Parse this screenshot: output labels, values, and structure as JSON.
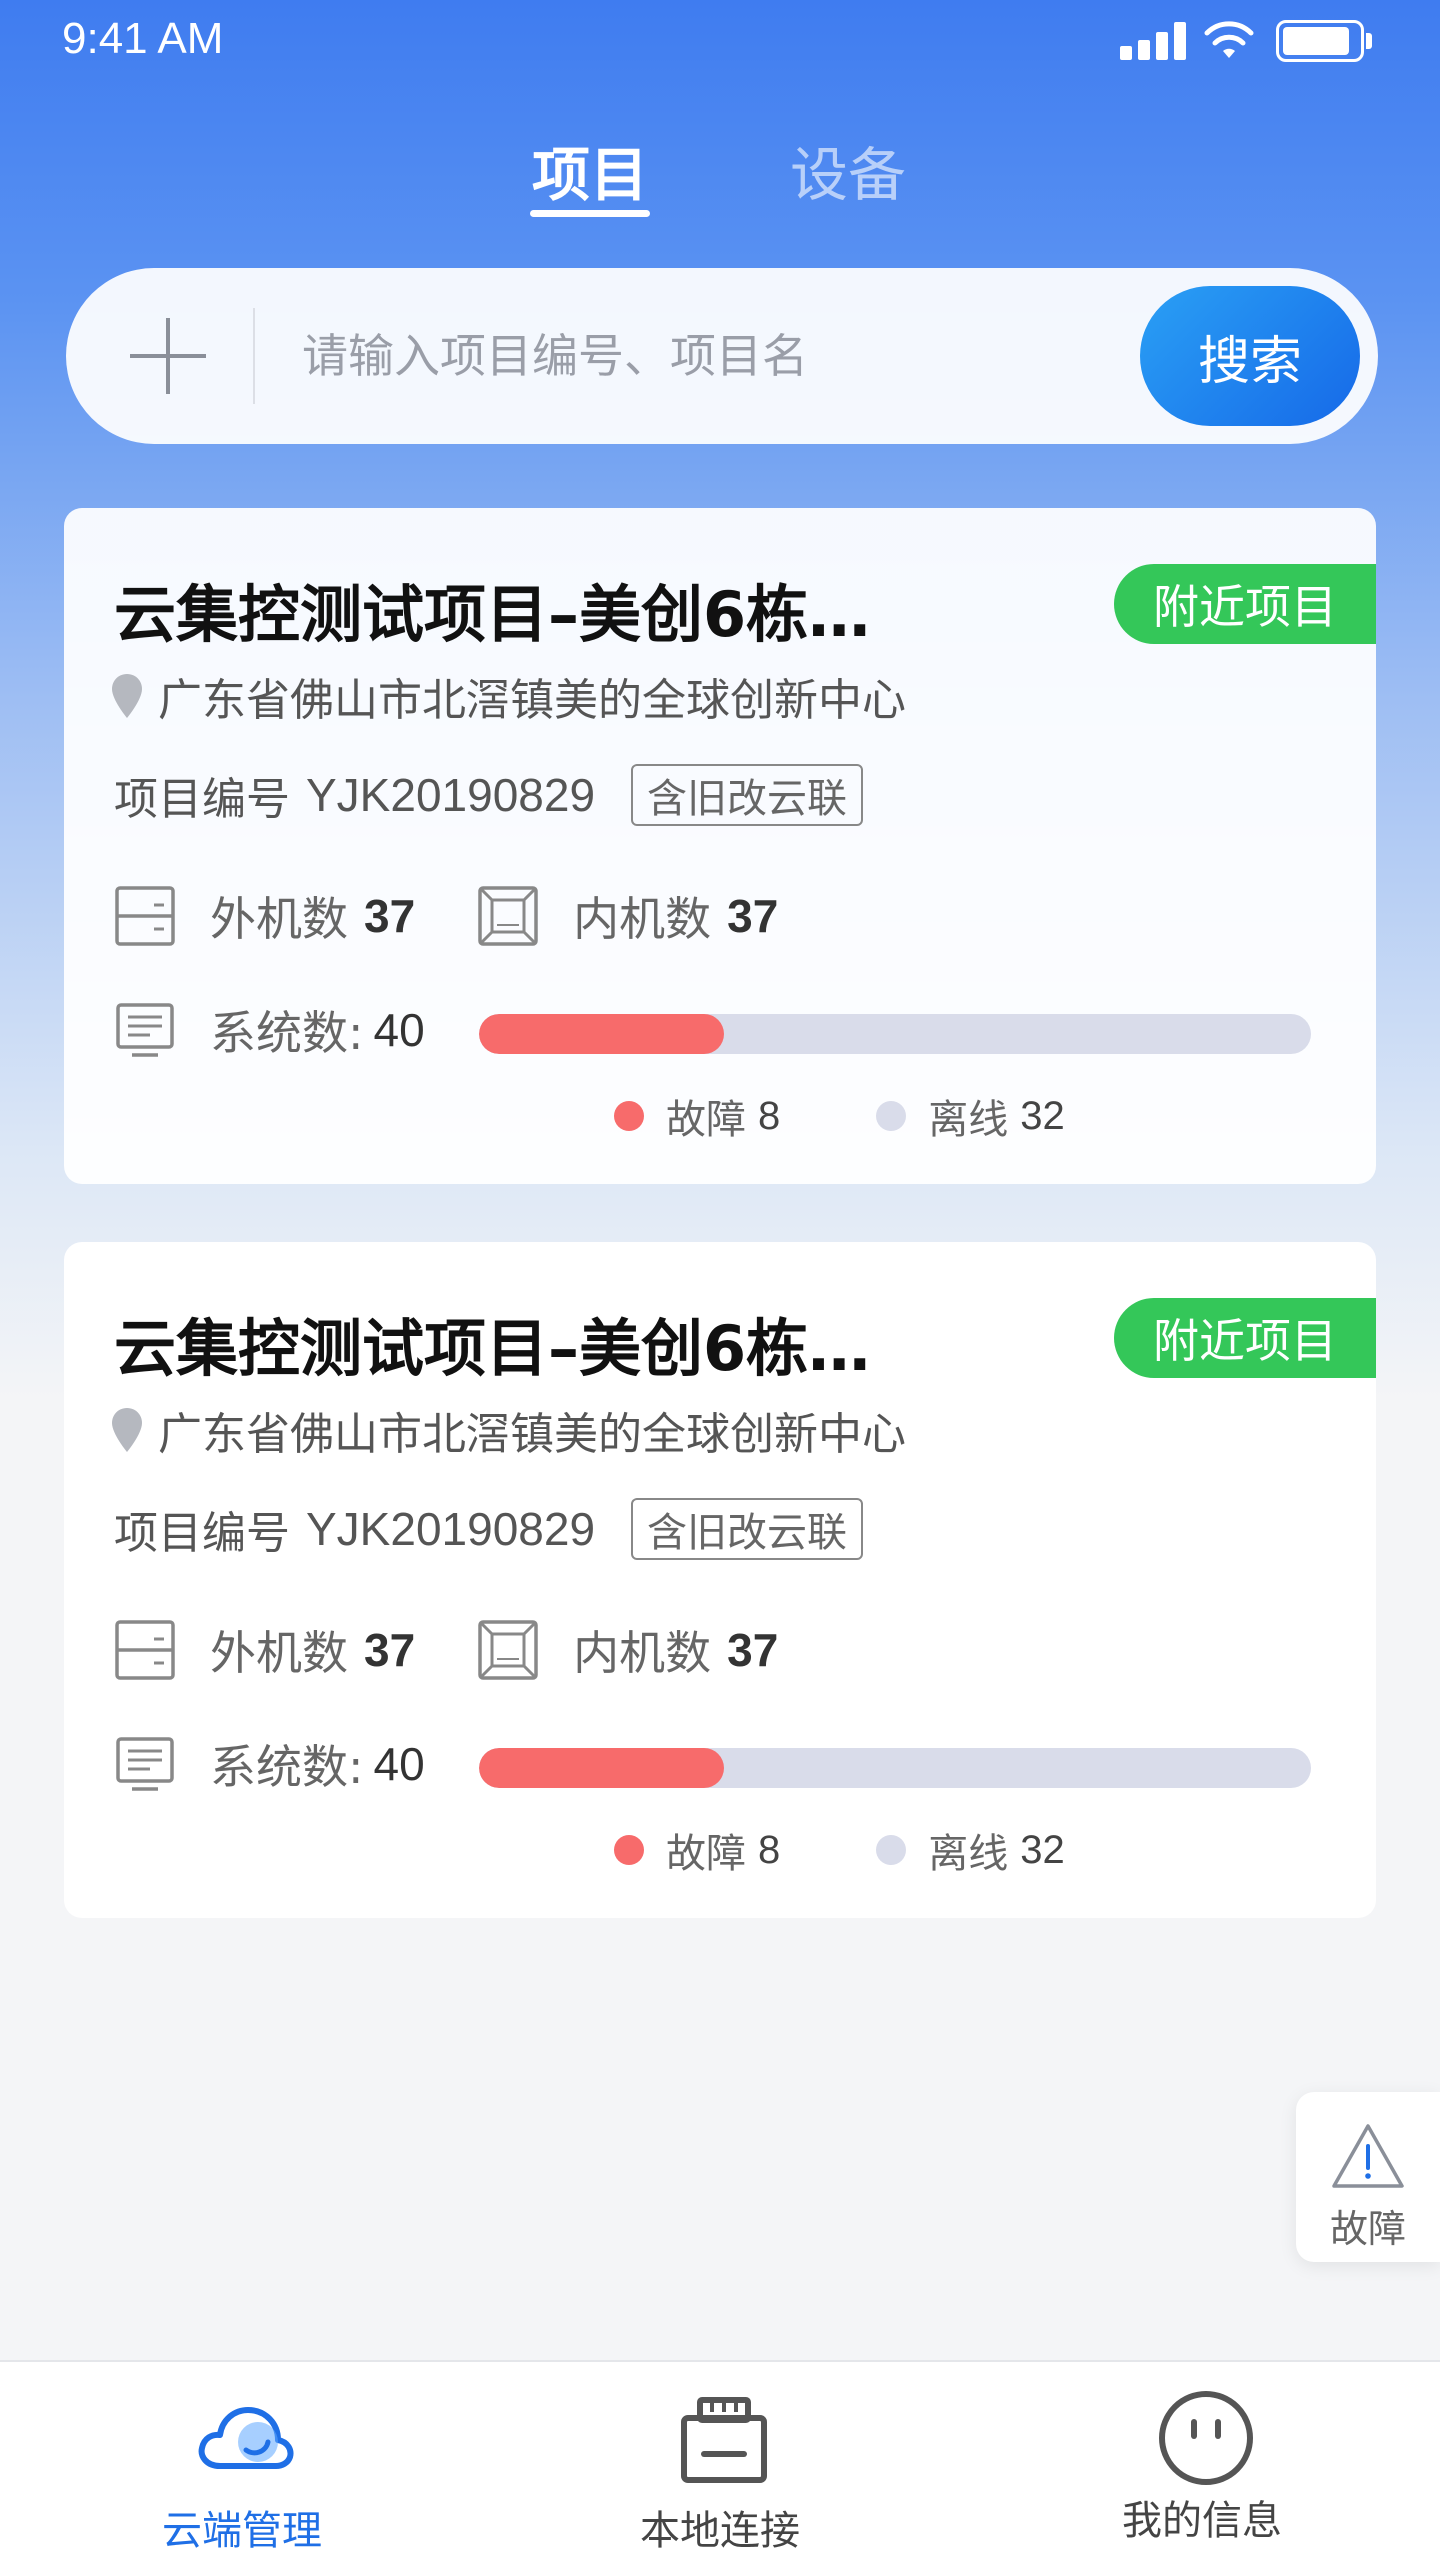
{
  "status_bar": {
    "time": "9:41 AM"
  },
  "tabs": [
    {
      "label": "项目",
      "active": true
    },
    {
      "label": "设备",
      "active": false
    }
  ],
  "search": {
    "placeholder": "请输入项目编号、项目名",
    "button_label": "搜索"
  },
  "projects": [
    {
      "title": "云集控测试项目–美创6栋…",
      "badge": "附近项目",
      "address": "广东省佛山市北滘镇美的全球创新中心",
      "code_label": "项目编号",
      "code": "YJK20190829",
      "tag": "含旧改云联",
      "outdoor_label": "外机数",
      "outdoor_count": "37",
      "indoor_label": "内机数",
      "indoor_count": "37",
      "system_label": "系统数:",
      "system_count": "40",
      "fault_label": "故障",
      "fault_count": "8",
      "offline_label": "离线",
      "offline_count": "32"
    },
    {
      "title": "云集控测试项目–美创6栋…",
      "badge": "附近项目",
      "address": "广东省佛山市北滘镇美的全球创新中心",
      "code_label": "项目编号",
      "code": "YJK20190829",
      "tag": "含旧改云联",
      "outdoor_label": "外机数",
      "outdoor_count": "37",
      "indoor_label": "内机数",
      "indoor_count": "37",
      "system_label": "系统数:",
      "system_count": "40",
      "fault_label": "故障",
      "fault_count": "8",
      "offline_label": "离线",
      "offline_count": "32"
    }
  ],
  "colors": {
    "accent": "#1f6fe6",
    "nearby_badge": "#34c759",
    "fault": "#f76b6b",
    "offline": "#d9dcea"
  },
  "fault_float": {
    "label": "故障",
    "icon": "warning-icon"
  },
  "bottom_nav": [
    {
      "label": "云端管理",
      "icon": "cloud-icon",
      "active": true
    },
    {
      "label": "本地连接",
      "icon": "router-icon",
      "active": false
    },
    {
      "label": "我的信息",
      "icon": "face-icon",
      "active": false
    }
  ]
}
